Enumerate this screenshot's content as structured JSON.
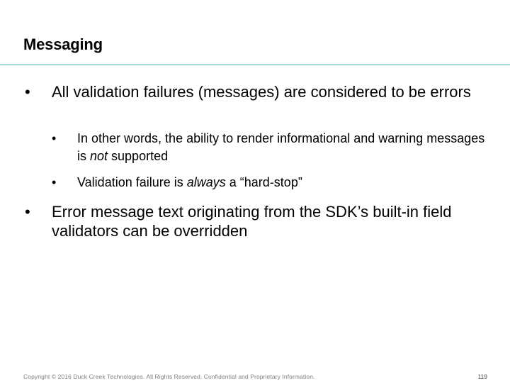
{
  "slide": {
    "title": "Messaging",
    "bullets": [
      {
        "marker": "•",
        "text": "All validation failures (messages) are considered to be errors",
        "sub": [
          {
            "marker": "•",
            "before": "In other words, the ability to render informational and warning messages is ",
            "emphasis": "not",
            "after": " supported"
          },
          {
            "marker": "•",
            "before": "Validation failure is ",
            "emphasis": "always",
            "after": " a “hard-stop”"
          }
        ]
      },
      {
        "marker": "•",
        "text": "Error message text originating from the SDK’s built-in field validators can be overridden"
      }
    ]
  },
  "footer": {
    "copyright": "Copyright © 2016 Duck Creek Technologies. All Rights Reserved. Confidential and Proprietary Information.",
    "page_number": "119"
  },
  "colors": {
    "title_rule": "#3fb8a6",
    "footer_text": "#7f7f7f"
  }
}
